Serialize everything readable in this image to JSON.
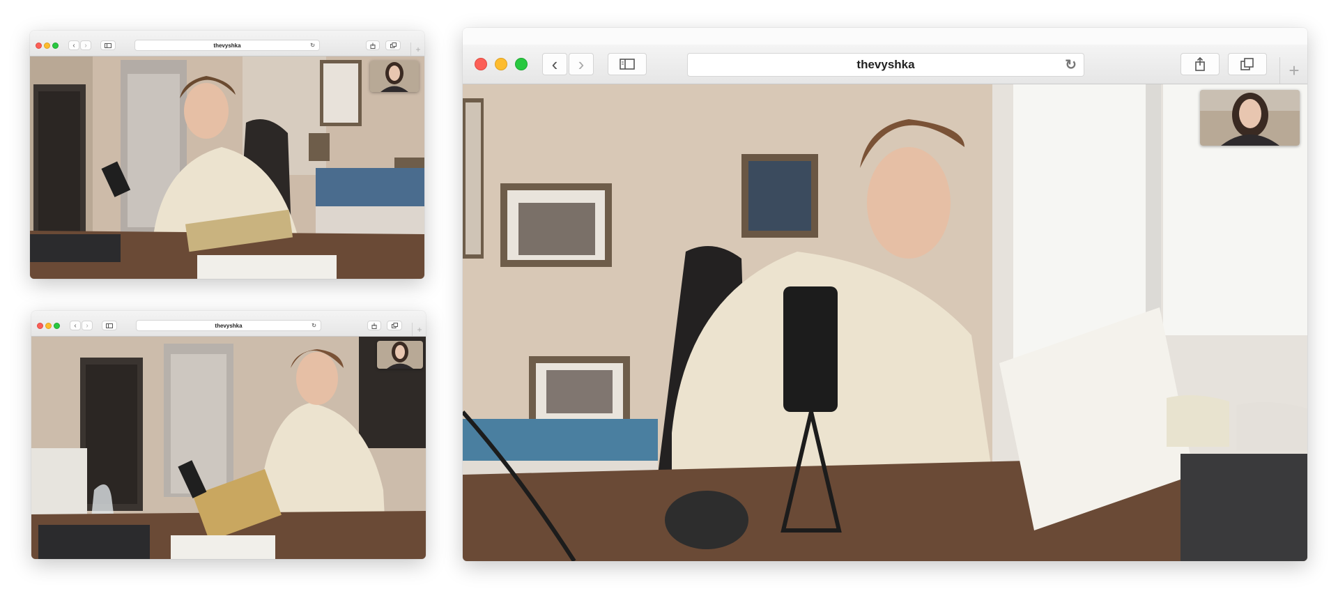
{
  "windows": {
    "top_left": {
      "address": "thevyshka"
    },
    "bottom_left": {
      "address": "thevyshka"
    },
    "main": {
      "address": "thevyshka"
    }
  },
  "icons": {
    "back": "chevron-left-icon",
    "forward": "chevron-right-icon",
    "sidebar": "sidebar-icon",
    "reload": "reload-icon",
    "share": "share-icon",
    "tabs": "tabs-icon",
    "new_tab": "plus-icon"
  },
  "colors": {
    "close": "#fc5f57",
    "minimize": "#fdbc2e",
    "zoom": "#28c840",
    "hoodie": "#ece3cf",
    "wall": "#d8c8b6"
  }
}
